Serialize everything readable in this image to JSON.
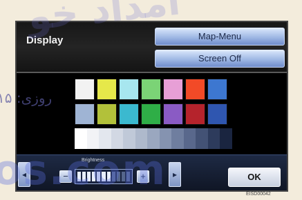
{
  "watermarks": {
    "top": "امداد خو",
    "left": "روزی: ۱۵",
    "bottom": "os.com"
  },
  "screen": {
    "title": "Display",
    "buttons": {
      "map_menu": "Map-Menu",
      "screen_off": "Screen Off",
      "ok": "OK"
    },
    "palette": {
      "row1": [
        "#f2f2f2",
        "#e6e84a",
        "#a7e6ef",
        "#7bd376",
        "#e79fd6",
        "#f24a27",
        "#3d77d0"
      ],
      "row2": [
        "#9fb4d4",
        "#b2c13a",
        "#3bb9cf",
        "#2fae47",
        "#8a5bc4",
        "#b5232c",
        "#2f56b0"
      ]
    },
    "gray_strip": [
      "#ffffff",
      "#f2f3f6",
      "#e3e7ee",
      "#d2d8e3",
      "#c0c9d8",
      "#aeb9cc",
      "#9aa7bf",
      "#8593b0",
      "#6f7e9f",
      "#59688c",
      "#435275",
      "#2d3b5c",
      "#1a2540"
    ],
    "brightness": {
      "label": "Brightness",
      "level": 0.6,
      "minus": "−",
      "plus": "+"
    },
    "arrows": {
      "left": "◂",
      "right": "▸"
    }
  },
  "reference_code": "EISD00042"
}
